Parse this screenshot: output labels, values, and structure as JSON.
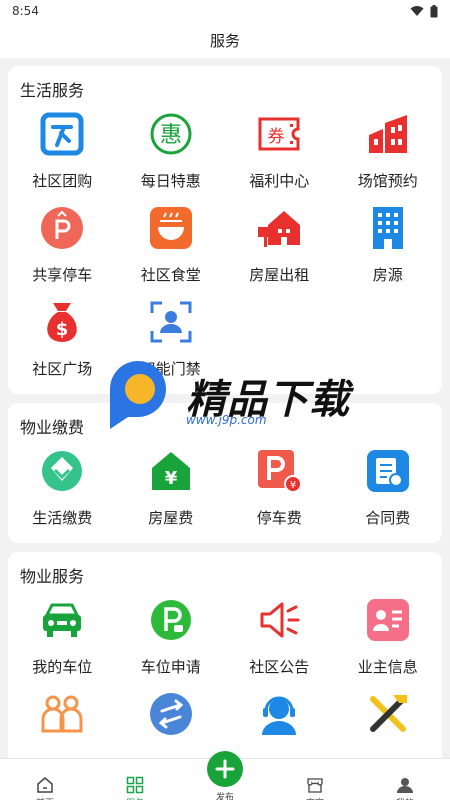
{
  "status": {
    "time": "8:54"
  },
  "header": {
    "title": "服务"
  },
  "sections": [
    {
      "title": "生活服务",
      "items": [
        {
          "label": "社区团购",
          "icon": "group-buy-icon"
        },
        {
          "label": "每日特惠",
          "icon": "daily-deal-icon"
        },
        {
          "label": "福利中心",
          "icon": "coupon-icon"
        },
        {
          "label": "场馆预约",
          "icon": "venue-icon"
        },
        {
          "label": "共享停车",
          "icon": "shared-parking-icon"
        },
        {
          "label": "社区食堂",
          "icon": "canteen-icon"
        },
        {
          "label": "房屋出租",
          "icon": "house-rent-icon"
        },
        {
          "label": "房源",
          "icon": "building-icon"
        },
        {
          "label": "社区广场",
          "icon": "money-bag-icon"
        },
        {
          "label": "智能门禁",
          "icon": "face-scan-icon"
        }
      ]
    },
    {
      "title": "物业缴费",
      "items": [
        {
          "label": "生活缴费",
          "icon": "utility-pay-icon"
        },
        {
          "label": "房屋费",
          "icon": "house-fee-icon"
        },
        {
          "label": "停车费",
          "icon": "parking-fee-icon"
        },
        {
          "label": "合同费",
          "icon": "contract-fee-icon"
        }
      ]
    },
    {
      "title": "物业服务",
      "items": [
        {
          "label": "我的车位",
          "icon": "car-icon"
        },
        {
          "label": "车位申请",
          "icon": "parking-apply-icon"
        },
        {
          "label": "社区公告",
          "icon": "announcement-icon"
        },
        {
          "label": "业主信息",
          "icon": "owner-info-icon"
        },
        {
          "label": "",
          "icon": "family-icon"
        },
        {
          "label": "",
          "icon": "transfer-icon"
        },
        {
          "label": "",
          "icon": "support-icon"
        },
        {
          "label": "",
          "icon": "repair-icon"
        }
      ]
    }
  ],
  "tabs": [
    {
      "label": "首页",
      "icon": "home-icon"
    },
    {
      "label": "服务",
      "icon": "grid-icon"
    },
    {
      "label": "发布",
      "icon": "plus-icon"
    },
    {
      "label": "商家",
      "icon": "shop-icon"
    },
    {
      "label": "我的",
      "icon": "user-icon"
    }
  ],
  "watermark": {
    "text": "精品下载",
    "url": "www.j9p.com"
  },
  "colors": {
    "accent": "#19a33b",
    "blue": "#1677d9",
    "red": "#e8312e",
    "orange": "#f26a2c"
  }
}
